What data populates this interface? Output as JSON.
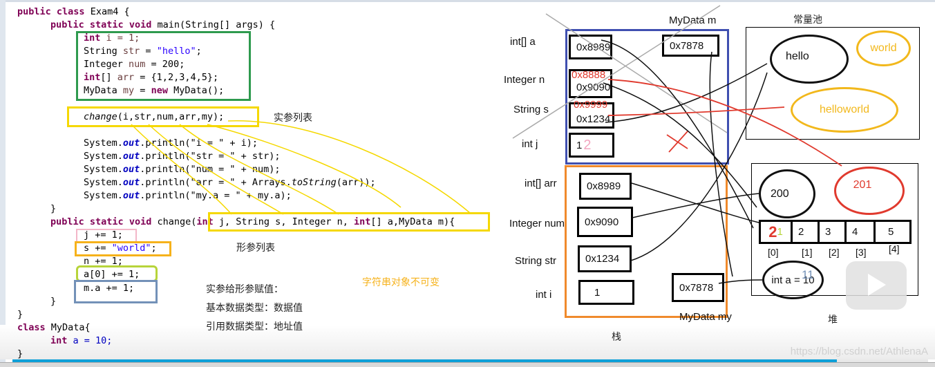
{
  "code": {
    "lines": {
      "l1": [
        "public",
        " ",
        "class",
        " Exam4 {"
      ],
      "main_sig": "main(String[] args) {",
      "decl_i": " i = 1;",
      "decl_str_type": "String ",
      "decl_str_var": "str",
      "decl_str_val": "\"hello\"",
      "decl_num_type": "Integer ",
      "decl_num_var": "num",
      "decl_num_val": " = 200;",
      "decl_arr_val": " = {1,2,3,4,5};",
      "decl_my_type": "MyData ",
      "decl_my_var": "my",
      "decl_my_rest": " MyData();",
      "call_name": "change",
      "call_args": "(i,str,num,arr,my);",
      "print_i": ".println(\"i = \" + i);",
      "print_str": ".println(\"str = \" + str);",
      "print_num": ".println(\"num = \" + num);",
      "print_arr_a": ".println(\"arr = \" + Arrays.",
      "print_arr_m": "toString",
      "print_arr_b": "(arr));",
      "print_my": ".println(\"my.a = \" + my.a);",
      "close_brace": "}",
      "change_sig_name": " change(",
      "change_params": [
        " j, String s, Integer n, ",
        "[] a,MyData m){"
      ],
      "stmt_j": "j += 1;",
      "stmt_s_a": "s += ",
      "stmt_s_b": "\"world\"",
      "stmt_n": "n += 1;",
      "stmt_a": "a[0] += 1;",
      "stmt_m": "m.a += 1;",
      "class2": " MyData{",
      "field_a": " a = 10;"
    },
    "keywords": {
      "public": "public",
      "static": "static",
      "void": "void",
      "class": "class",
      "int": "int",
      "new": "new"
    },
    "system": "System.",
    "out": "out"
  },
  "annotations": {
    "actual_params": "实参列表",
    "formal_params": "形参列表",
    "string_immutable": "字符串对象不可变",
    "assign_title": "实参给形参赋值：",
    "primitive_rule": "基本数据类型：数据值",
    "reference_rule": "引用数据类型：地址值"
  },
  "diagram": {
    "change_frame": {
      "title": "MyData m",
      "vars": [
        {
          "label": "int[]  a",
          "value": "0x8989"
        },
        {
          "label": "Integer n",
          "value": "0x9090",
          "overwritten": "0x8888"
        },
        {
          "label": "String  s",
          "value": "0x1234",
          "overwritten": "0x9999"
        },
        {
          "label": "int  j",
          "value": "1",
          "scribble": "2"
        }
      ],
      "m_value": "0x7878"
    },
    "main_frame": {
      "vars": [
        {
          "label": "int[]    arr",
          "value": "0x8989"
        },
        {
          "label": "Integer num",
          "value": "0x9090"
        },
        {
          "label": "String str",
          "value": "0x1234"
        },
        {
          "label": "int  i",
          "value": "1"
        }
      ],
      "my_value": "0x7878",
      "my_label": "MyData my",
      "stack_label": "栈"
    },
    "constant_pool": {
      "title": "常量池",
      "hello": "hello",
      "world": "world",
      "helloworld": "helloworld"
    },
    "heap": {
      "label": "堆",
      "int200": "200",
      "int201": "201",
      "array": [
        "1",
        "2",
        "3",
        "4",
        "5"
      ],
      "array_overwrite": "2",
      "indices": [
        "[0]",
        "[1]",
        "[2]",
        "[3]",
        "[4]"
      ],
      "object_field": "int a = 10",
      "object_overwrite": "11"
    }
  },
  "player": {
    "progress": 0.9
  },
  "watermark": "https://blog.csdn.net/AthlenaA",
  "colors": {
    "green_box": "#2e9a4e",
    "yellow": "#f5d800",
    "pink": "#f3b6c8",
    "orange": "#f6b21b",
    "lime": "#b7d43a",
    "steel": "#7391b8",
    "blue_frame": "#3f4fb0",
    "orange_frame": "#f08a2c",
    "red": "#e03a2e",
    "gold": "#f2b81c"
  }
}
